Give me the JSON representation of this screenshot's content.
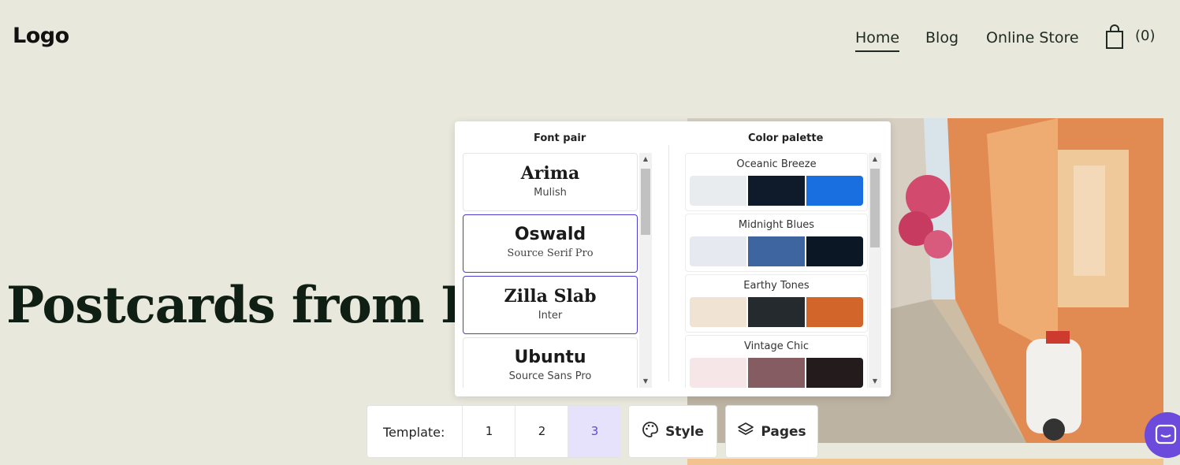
{
  "header": {
    "logo": "Logo",
    "nav": [
      {
        "label": "Home",
        "active": true
      },
      {
        "label": "Blog",
        "active": false
      },
      {
        "label": "Online Store",
        "active": false
      }
    ],
    "cart_count": "(0)",
    "cart_icon": "shopping-bag-icon"
  },
  "hero": {
    "title": "Postcards from Ita"
  },
  "style_panel": {
    "font_pair_heading": "Font pair",
    "color_palette_heading": "Color palette",
    "font_pairs": [
      {
        "heading": "Arima",
        "body": "Mulish",
        "selected": false
      },
      {
        "heading": "Oswald",
        "body": "Source Serif Pro",
        "selected": true
      },
      {
        "heading": "Zilla Slab",
        "body": "Inter",
        "selected": true
      },
      {
        "heading": "Ubuntu",
        "body": "Source Sans Pro",
        "selected": false
      }
    ],
    "palettes": [
      {
        "name": "Oceanic Breeze",
        "colors": [
          "#e9ecef",
          "#0f1a2a",
          "#1a6fe0"
        ]
      },
      {
        "name": "Midnight Blues",
        "colors": [
          "#e6eaf0",
          "#3e65a0",
          "#0c1726"
        ]
      },
      {
        "name": "Earthy Tones",
        "colors": [
          "#f1e3d3",
          "#252a2e",
          "#d2652a"
        ]
      },
      {
        "name": "Vintage Chic",
        "colors": [
          "#f6e6e8",
          "#845c62",
          "#241c1c"
        ]
      }
    ]
  },
  "toolbar": {
    "template_label": "Template:",
    "templates": [
      "1",
      "2",
      "3"
    ],
    "active_template": "3",
    "style_label": "Style",
    "pages_label": "Pages"
  }
}
